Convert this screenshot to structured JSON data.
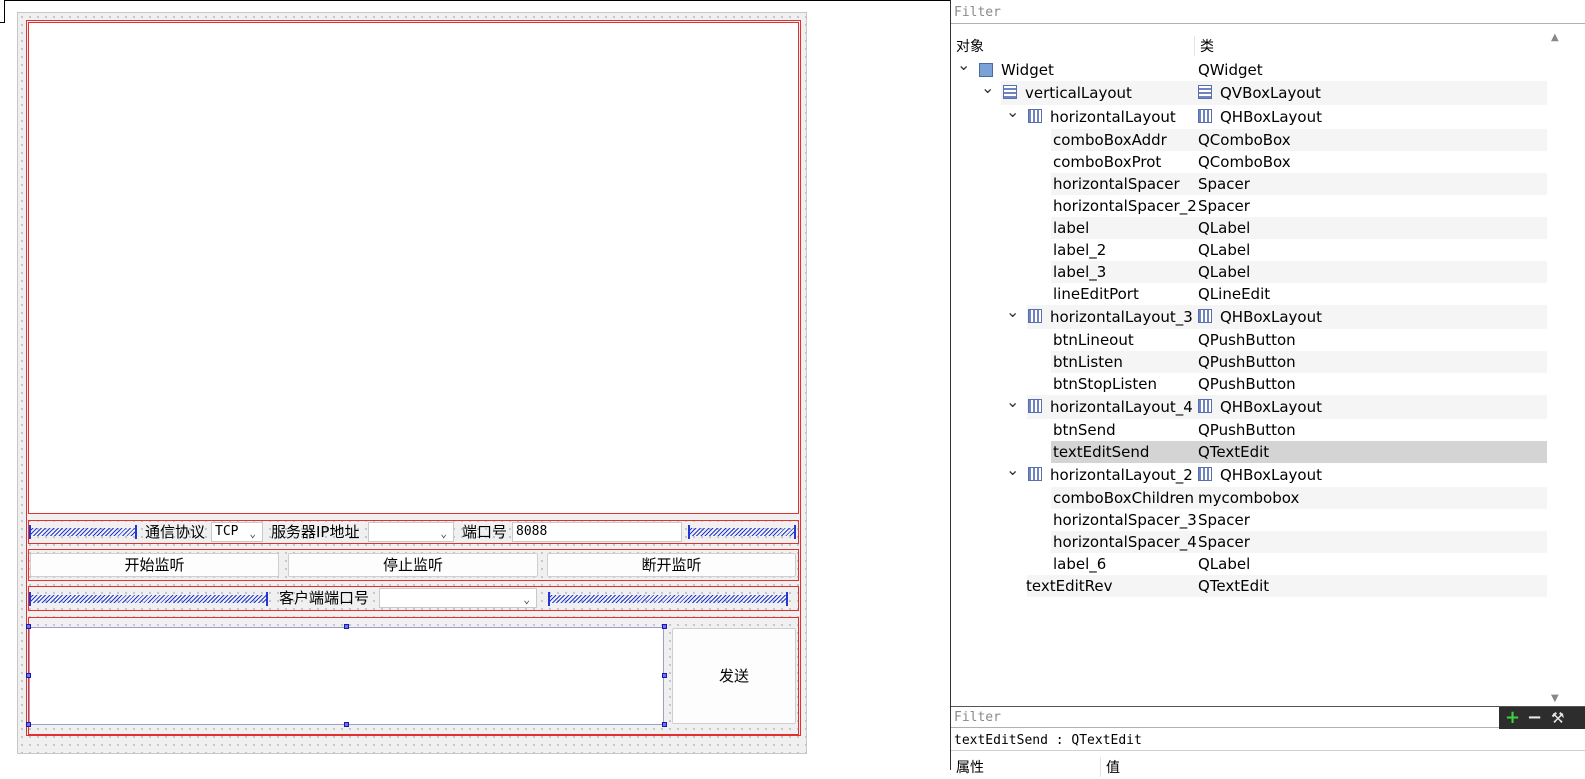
{
  "form": {
    "protocol_label": "通信协议",
    "protocol_value": "TCP",
    "server_ip_label": "服务器IP地址",
    "server_ip_value": "",
    "port_label": "端口号",
    "port_value": "8088",
    "btn_listen": "开始监听",
    "btn_stop_listen": "停止监听",
    "btn_lineout": "断开监听",
    "client_port_label": "客户端端口号",
    "client_port_value": "",
    "btn_send": "发送"
  },
  "inspector": {
    "filter_placeholder": "Filter",
    "col_object": "对象",
    "col_class": "类",
    "tree": [
      {
        "name": "Widget",
        "cls": "QWidget",
        "depth": 0,
        "expand": "v",
        "icon": "widget-icon",
        "cls_icon": ""
      },
      {
        "name": "verticalLayout",
        "cls": "QVBoxLayout",
        "depth": 1,
        "expand": "v",
        "icon": "vbox-layout-icon",
        "cls_icon": "vbox-layout-icon"
      },
      {
        "name": "horizontalLayout",
        "cls": "QHBoxLayout",
        "depth": 2,
        "expand": "v",
        "icon": "hbox-layout-icon",
        "cls_icon": "hbox-layout-icon"
      },
      {
        "name": "comboBoxAddr",
        "cls": "QComboBox",
        "depth": 3
      },
      {
        "name": "comboBoxProt",
        "cls": "QComboBox",
        "depth": 3
      },
      {
        "name": "horizontalSpacer",
        "cls": "Spacer",
        "depth": 3
      },
      {
        "name": "horizontalSpacer_2",
        "cls": "Spacer",
        "depth": 3
      },
      {
        "name": "label",
        "cls": "QLabel",
        "depth": 3
      },
      {
        "name": "label_2",
        "cls": "QLabel",
        "depth": 3
      },
      {
        "name": "label_3",
        "cls": "QLabel",
        "depth": 3
      },
      {
        "name": "lineEditPort",
        "cls": "QLineEdit",
        "depth": 3
      },
      {
        "name": "horizontalLayout_3",
        "cls": "QHBoxLayout",
        "depth": 2,
        "expand": "v",
        "icon": "hbox-layout-icon",
        "cls_icon": "hbox-layout-icon"
      },
      {
        "name": "btnLineout",
        "cls": "QPushButton",
        "depth": 3
      },
      {
        "name": "btnListen",
        "cls": "QPushButton",
        "depth": 3
      },
      {
        "name": "btnStopListen",
        "cls": "QPushButton",
        "depth": 3
      },
      {
        "name": "horizontalLayout_4",
        "cls": "QHBoxLayout",
        "depth": 2,
        "expand": "v",
        "icon": "hbox-layout-icon",
        "cls_icon": "hbox-layout-icon"
      },
      {
        "name": "btnSend",
        "cls": "QPushButton",
        "depth": 3
      },
      {
        "name": "textEditSend",
        "cls": "QTextEdit",
        "depth": 3,
        "selected": true
      },
      {
        "name": "horizontalLayout_2",
        "cls": "QHBoxLayout",
        "depth": 2,
        "expand": "v",
        "icon": "hbox-layout-icon",
        "cls_icon": "hbox-layout-icon"
      },
      {
        "name": "comboBoxChildren",
        "cls": "mycombobox",
        "depth": 3
      },
      {
        "name": "horizontalSpacer_3",
        "cls": "Spacer",
        "depth": 3
      },
      {
        "name": "horizontalSpacer_4",
        "cls": "Spacer",
        "depth": 3
      },
      {
        "name": "label_6",
        "cls": "QLabel",
        "depth": 3
      },
      {
        "name": "textEditRev",
        "cls": "QTextEdit",
        "depth": 2
      }
    ],
    "prop_filter_placeholder": "Filter",
    "prop_title": "textEditSend : QTextEdit",
    "prop_col_property": "属性",
    "prop_col_value": "值",
    "colors": {
      "add": "#3bd23b",
      "tool": "#e6e6e6"
    }
  }
}
